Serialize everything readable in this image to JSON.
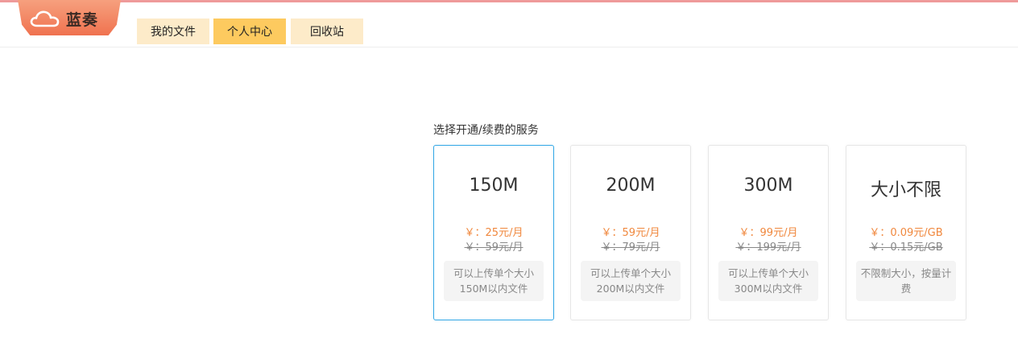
{
  "app": {
    "logo_text": "蓝奏"
  },
  "nav": {
    "tabs": [
      {
        "label": "我的文件"
      },
      {
        "label": "个人中心"
      },
      {
        "label": "回收站"
      }
    ],
    "active_tab": "个人中心"
  },
  "colors": {
    "accent_orange": "#f0883e",
    "active_tab": "#fdca5f",
    "tab_bg": "#fdebc9",
    "selected_border": "#2fa6e6"
  },
  "service": {
    "title": "选择开通/续费的服务",
    "plans": [
      {
        "size": "150M",
        "price": "￥：25元/月",
        "old_price": "￥：59元/月",
        "desc": "可以上传单个大小150M以内文件",
        "selected": true
      },
      {
        "size": "200M",
        "price": "￥：59元/月",
        "old_price": "￥：79元/月",
        "desc": "可以上传单个大小200M以内文件",
        "selected": false
      },
      {
        "size": "300M",
        "price": "￥：99元/月",
        "old_price": "￥：199元/月",
        "desc": "可以上传单个大小300M以内文件",
        "selected": false
      },
      {
        "size": "大小不限",
        "price": "￥：0.09元/GB",
        "old_price": "￥：0.15元/GB",
        "desc": "不限制大小，按量计费",
        "selected": false
      }
    ]
  }
}
